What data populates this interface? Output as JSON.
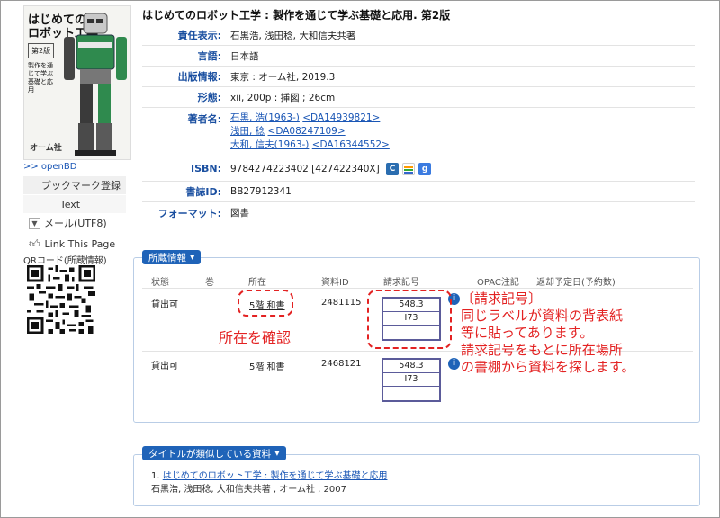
{
  "book": {
    "title": "はじめてのロボット工学 : 製作を通じて学ぶ基礎と応用. 第2版",
    "cover": {
      "title_line1": "はじめての",
      "title_line2": "ロボット工学",
      "edition": "第2版",
      "subtitle": "製作を通じて学ぶ基礎と応用",
      "publisher_mark": "オーム社"
    }
  },
  "sidebar": {
    "openbd": ">> openBD",
    "bookmark": "ブックマーク登録",
    "text": "Text",
    "mail": "メール(UTF8)",
    "link_this_page": "Link This Page",
    "qr_label": "QRコード(所蔵情報)"
  },
  "detail": {
    "responsibility": {
      "label": "責任表示:",
      "value": "石黒浩, 浅田稔, 大和信夫共著"
    },
    "language": {
      "label": "言語:",
      "value": "日本語"
    },
    "publication": {
      "label": "出版情報:",
      "value": "東京 : オーム社, 2019.3"
    },
    "form": {
      "label": "形態:",
      "value": "xii, 200p : 挿図 ; 26cm"
    },
    "authors": {
      "label": "著者名:",
      "items": [
        {
          "name": "石黒, 浩(1963-)",
          "id": "<DA14939821>"
        },
        {
          "name": "浅田, 稔",
          "id": "<DA08247109>"
        },
        {
          "name": "大和, 信夫(1963-)",
          "id": "<DA16344552>"
        }
      ]
    },
    "isbn": {
      "label": "ISBN:",
      "value": "9784274223402 [427422340X]"
    },
    "bib_id": {
      "label": "書誌ID:",
      "value": "BB27912341"
    },
    "format": {
      "label": "フォーマット:",
      "value": "図書"
    }
  },
  "holdings": {
    "tab_label": "所蔵情報",
    "columns": [
      "状態",
      "巻",
      "所在",
      "資料ID",
      "請求記号",
      "OPAC注記",
      "返却予定日(予約数)"
    ],
    "rows": [
      {
        "status": "貸出可",
        "location": "5階 和書",
        "item_id": "2481115",
        "call_number": [
          "548.3",
          "I73",
          ""
        ]
      },
      {
        "status": "貸出可",
        "location": "5階 和書",
        "item_id": "2468121",
        "call_number": [
          "548.3",
          "I73",
          ""
        ]
      }
    ]
  },
  "annotations": {
    "location_note": "所在を確認",
    "call_note_1": "〔請求記号〕",
    "call_note_2": "同じラベルが資料の背表紙",
    "call_note_3": "等に貼ってあります。",
    "call_note_4": "請求記号をもとに所在場所",
    "call_note_5": "の書棚から資料を探します。"
  },
  "similar": {
    "tab_label": "タイトルが類似している資料",
    "items": [
      {
        "index": "1.",
        "title": "はじめてのロボット工学 : 製作を通じて学ぶ基礎と応用",
        "meta": "石黒浩, 浅田稔, 大和信夫共著 , オーム社 , 2007"
      }
    ]
  },
  "colors": {
    "accent": "#1f63b8",
    "annotation": "#e32222",
    "label": "#1a4fa0"
  }
}
